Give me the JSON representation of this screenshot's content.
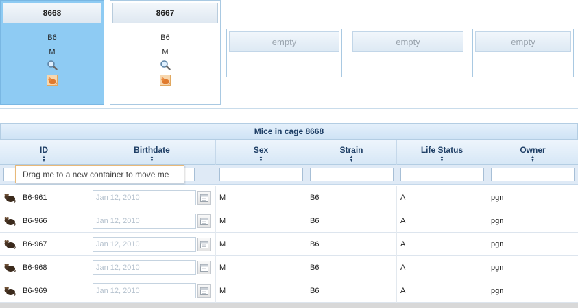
{
  "cages": [
    {
      "id": "8668",
      "strain": "B6",
      "sex": "M",
      "selected": true
    },
    {
      "id": "8667",
      "strain": "B6",
      "sex": "M",
      "selected": false
    }
  ],
  "empty_slots": [
    "empty",
    "empty",
    "empty"
  ],
  "icons": {
    "search": "magnifier-icon",
    "cage": "orange-mouse-icon",
    "mouse": "dark-mouse-icon",
    "calendar": "calendar-icon"
  },
  "grid": {
    "caption": "Mice in cage 8668",
    "columns": [
      "ID",
      "Birthdate",
      "Sex",
      "Strain",
      "Life Status",
      "Owner"
    ],
    "sort_glyph": "▲▼",
    "rows": [
      {
        "id": "B6-961",
        "birthdate": "Jan 12, 2010",
        "sex": "M",
        "strain": "B6",
        "life_status": "A",
        "owner": "pgn"
      },
      {
        "id": "B6-966",
        "birthdate": "Jan 12, 2010",
        "sex": "M",
        "strain": "B6",
        "life_status": "A",
        "owner": "pgn"
      },
      {
        "id": "B6-967",
        "birthdate": "Jan 12, 2010",
        "sex": "M",
        "strain": "B6",
        "life_status": "A",
        "owner": "pgn"
      },
      {
        "id": "B6-968",
        "birthdate": "Jan 12, 2010",
        "sex": "M",
        "strain": "B6",
        "life_status": "A",
        "owner": "pgn"
      },
      {
        "id": "B6-969",
        "birthdate": "Jan 12, 2010",
        "sex": "M",
        "strain": "B6",
        "life_status": "A",
        "owner": "pgn"
      }
    ]
  },
  "tooltip": "Drag me to a new container to move me",
  "colors": {
    "selected_cage": "#8ecbf3",
    "header_text": "#1f3f66",
    "tooltip_border": "#e8b979"
  }
}
